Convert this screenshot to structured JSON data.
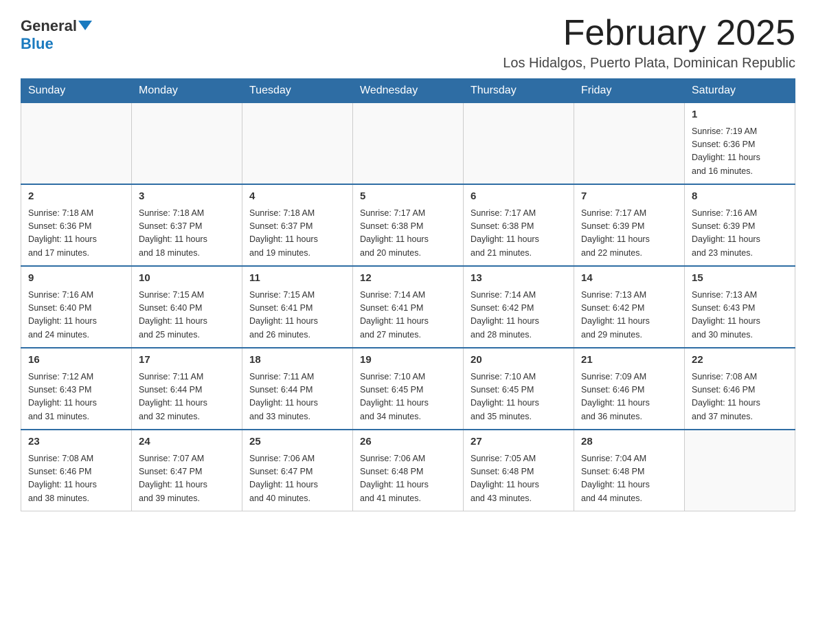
{
  "header": {
    "logo_general": "General",
    "logo_blue": "Blue",
    "month_title": "February 2025",
    "location": "Los Hidalgos, Puerto Plata, Dominican Republic"
  },
  "calendar": {
    "days_of_week": [
      "Sunday",
      "Monday",
      "Tuesday",
      "Wednesday",
      "Thursday",
      "Friday",
      "Saturday"
    ],
    "weeks": [
      [
        {
          "day": "",
          "info": ""
        },
        {
          "day": "",
          "info": ""
        },
        {
          "day": "",
          "info": ""
        },
        {
          "day": "",
          "info": ""
        },
        {
          "day": "",
          "info": ""
        },
        {
          "day": "",
          "info": ""
        },
        {
          "day": "1",
          "info": "Sunrise: 7:19 AM\nSunset: 6:36 PM\nDaylight: 11 hours\nand 16 minutes."
        }
      ],
      [
        {
          "day": "2",
          "info": "Sunrise: 7:18 AM\nSunset: 6:36 PM\nDaylight: 11 hours\nand 17 minutes."
        },
        {
          "day": "3",
          "info": "Sunrise: 7:18 AM\nSunset: 6:37 PM\nDaylight: 11 hours\nand 18 minutes."
        },
        {
          "day": "4",
          "info": "Sunrise: 7:18 AM\nSunset: 6:37 PM\nDaylight: 11 hours\nand 19 minutes."
        },
        {
          "day": "5",
          "info": "Sunrise: 7:17 AM\nSunset: 6:38 PM\nDaylight: 11 hours\nand 20 minutes."
        },
        {
          "day": "6",
          "info": "Sunrise: 7:17 AM\nSunset: 6:38 PM\nDaylight: 11 hours\nand 21 minutes."
        },
        {
          "day": "7",
          "info": "Sunrise: 7:17 AM\nSunset: 6:39 PM\nDaylight: 11 hours\nand 22 minutes."
        },
        {
          "day": "8",
          "info": "Sunrise: 7:16 AM\nSunset: 6:39 PM\nDaylight: 11 hours\nand 23 minutes."
        }
      ],
      [
        {
          "day": "9",
          "info": "Sunrise: 7:16 AM\nSunset: 6:40 PM\nDaylight: 11 hours\nand 24 minutes."
        },
        {
          "day": "10",
          "info": "Sunrise: 7:15 AM\nSunset: 6:40 PM\nDaylight: 11 hours\nand 25 minutes."
        },
        {
          "day": "11",
          "info": "Sunrise: 7:15 AM\nSunset: 6:41 PM\nDaylight: 11 hours\nand 26 minutes."
        },
        {
          "day": "12",
          "info": "Sunrise: 7:14 AM\nSunset: 6:41 PM\nDaylight: 11 hours\nand 27 minutes."
        },
        {
          "day": "13",
          "info": "Sunrise: 7:14 AM\nSunset: 6:42 PM\nDaylight: 11 hours\nand 28 minutes."
        },
        {
          "day": "14",
          "info": "Sunrise: 7:13 AM\nSunset: 6:42 PM\nDaylight: 11 hours\nand 29 minutes."
        },
        {
          "day": "15",
          "info": "Sunrise: 7:13 AM\nSunset: 6:43 PM\nDaylight: 11 hours\nand 30 minutes."
        }
      ],
      [
        {
          "day": "16",
          "info": "Sunrise: 7:12 AM\nSunset: 6:43 PM\nDaylight: 11 hours\nand 31 minutes."
        },
        {
          "day": "17",
          "info": "Sunrise: 7:11 AM\nSunset: 6:44 PM\nDaylight: 11 hours\nand 32 minutes."
        },
        {
          "day": "18",
          "info": "Sunrise: 7:11 AM\nSunset: 6:44 PM\nDaylight: 11 hours\nand 33 minutes."
        },
        {
          "day": "19",
          "info": "Sunrise: 7:10 AM\nSunset: 6:45 PM\nDaylight: 11 hours\nand 34 minutes."
        },
        {
          "day": "20",
          "info": "Sunrise: 7:10 AM\nSunset: 6:45 PM\nDaylight: 11 hours\nand 35 minutes."
        },
        {
          "day": "21",
          "info": "Sunrise: 7:09 AM\nSunset: 6:46 PM\nDaylight: 11 hours\nand 36 minutes."
        },
        {
          "day": "22",
          "info": "Sunrise: 7:08 AM\nSunset: 6:46 PM\nDaylight: 11 hours\nand 37 minutes."
        }
      ],
      [
        {
          "day": "23",
          "info": "Sunrise: 7:08 AM\nSunset: 6:46 PM\nDaylight: 11 hours\nand 38 minutes."
        },
        {
          "day": "24",
          "info": "Sunrise: 7:07 AM\nSunset: 6:47 PM\nDaylight: 11 hours\nand 39 minutes."
        },
        {
          "day": "25",
          "info": "Sunrise: 7:06 AM\nSunset: 6:47 PM\nDaylight: 11 hours\nand 40 minutes."
        },
        {
          "day": "26",
          "info": "Sunrise: 7:06 AM\nSunset: 6:48 PM\nDaylight: 11 hours\nand 41 minutes."
        },
        {
          "day": "27",
          "info": "Sunrise: 7:05 AM\nSunset: 6:48 PM\nDaylight: 11 hours\nand 43 minutes."
        },
        {
          "day": "28",
          "info": "Sunrise: 7:04 AM\nSunset: 6:48 PM\nDaylight: 11 hours\nand 44 minutes."
        },
        {
          "day": "",
          "info": ""
        }
      ]
    ]
  }
}
